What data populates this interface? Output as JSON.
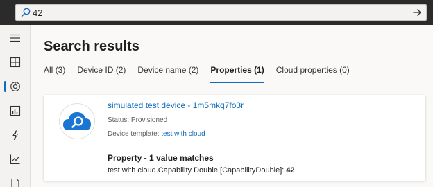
{
  "search": {
    "value": "42"
  },
  "nav": {
    "items": [
      {
        "icon": "menu-icon"
      },
      {
        "icon": "dashboard-icon"
      },
      {
        "icon": "devices-icon",
        "active": true
      },
      {
        "icon": "device-groups-icon"
      },
      {
        "icon": "rules-icon"
      },
      {
        "icon": "analytics-icon"
      },
      {
        "icon": "document-icon"
      }
    ]
  },
  "main": {
    "title": "Search results",
    "tabs": [
      {
        "label": "All (3)"
      },
      {
        "label": "Device ID (2)"
      },
      {
        "label": "Device name (2)"
      },
      {
        "label": "Properties (1)",
        "selected": true
      },
      {
        "label": "Cloud properties (0)"
      }
    ]
  },
  "result": {
    "device_name": "simulated test device - 1m5mkq7fo3r",
    "status_label": "Status:",
    "status_value": "Provisioned",
    "template_label": "Device template:",
    "template_value": "test with cloud",
    "match_header": "Property - 1 value matches",
    "match_text": "test with cloud.Capability Double [CapabilityDouble]:",
    "match_value": "42"
  },
  "colors": {
    "accent": "#0f6cbd",
    "topbar": "#2b2b2b",
    "avatar_blue": "#1976d2"
  }
}
